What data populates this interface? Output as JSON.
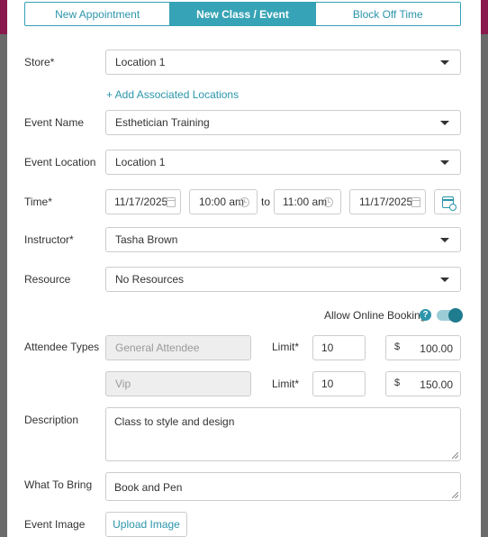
{
  "tabs": [
    {
      "label": "New Appointment",
      "active": false
    },
    {
      "label": "New Class / Event",
      "active": true
    },
    {
      "label": "Block Off Time",
      "active": false
    }
  ],
  "store": {
    "label": "Store*",
    "value": "Location 1"
  },
  "add_locations_link": "+ Add Associated Locations",
  "event_name": {
    "label": "Event Name",
    "value": "Esthetician Training"
  },
  "event_location": {
    "label": "Event Location",
    "value": "Location 1"
  },
  "time": {
    "label": "Time*",
    "start_date": "11/17/2025",
    "start_time": "10:00 am",
    "separator": "to",
    "end_time": "11:00 am",
    "end_date": "11/17/2025"
  },
  "instructor": {
    "label": "Instructor*",
    "value": "Tasha Brown"
  },
  "resource": {
    "label": "Resource",
    "value": "No Resources"
  },
  "online_booking": {
    "label": "Allow Online Booking",
    "help": "?",
    "enabled": true
  },
  "attendee_types": {
    "label": "Attendee Types",
    "rows": [
      {
        "name": "General Attendee",
        "limit_label": "Limit*",
        "limit": "10",
        "currency": "$",
        "price": "100.00"
      },
      {
        "name": "Vip",
        "limit_label": "Limit*",
        "limit": "10",
        "currency": "$",
        "price": "150.00"
      }
    ]
  },
  "description": {
    "label": "Description",
    "value": "Class to style and design"
  },
  "what_to_bring": {
    "label": "What To Bring",
    "value": "Book and Pen"
  },
  "event_image": {
    "label": "Event Image",
    "button": "Upload Image"
  },
  "colors": {
    "accent": "#37a3b6",
    "link": "#2b95ab",
    "toggle_on": "#1f7b8e"
  },
  "icons": [
    "calendar-icon",
    "clock-icon",
    "calendar-refresh-icon",
    "help-icon",
    "chevron-down-icon"
  ]
}
